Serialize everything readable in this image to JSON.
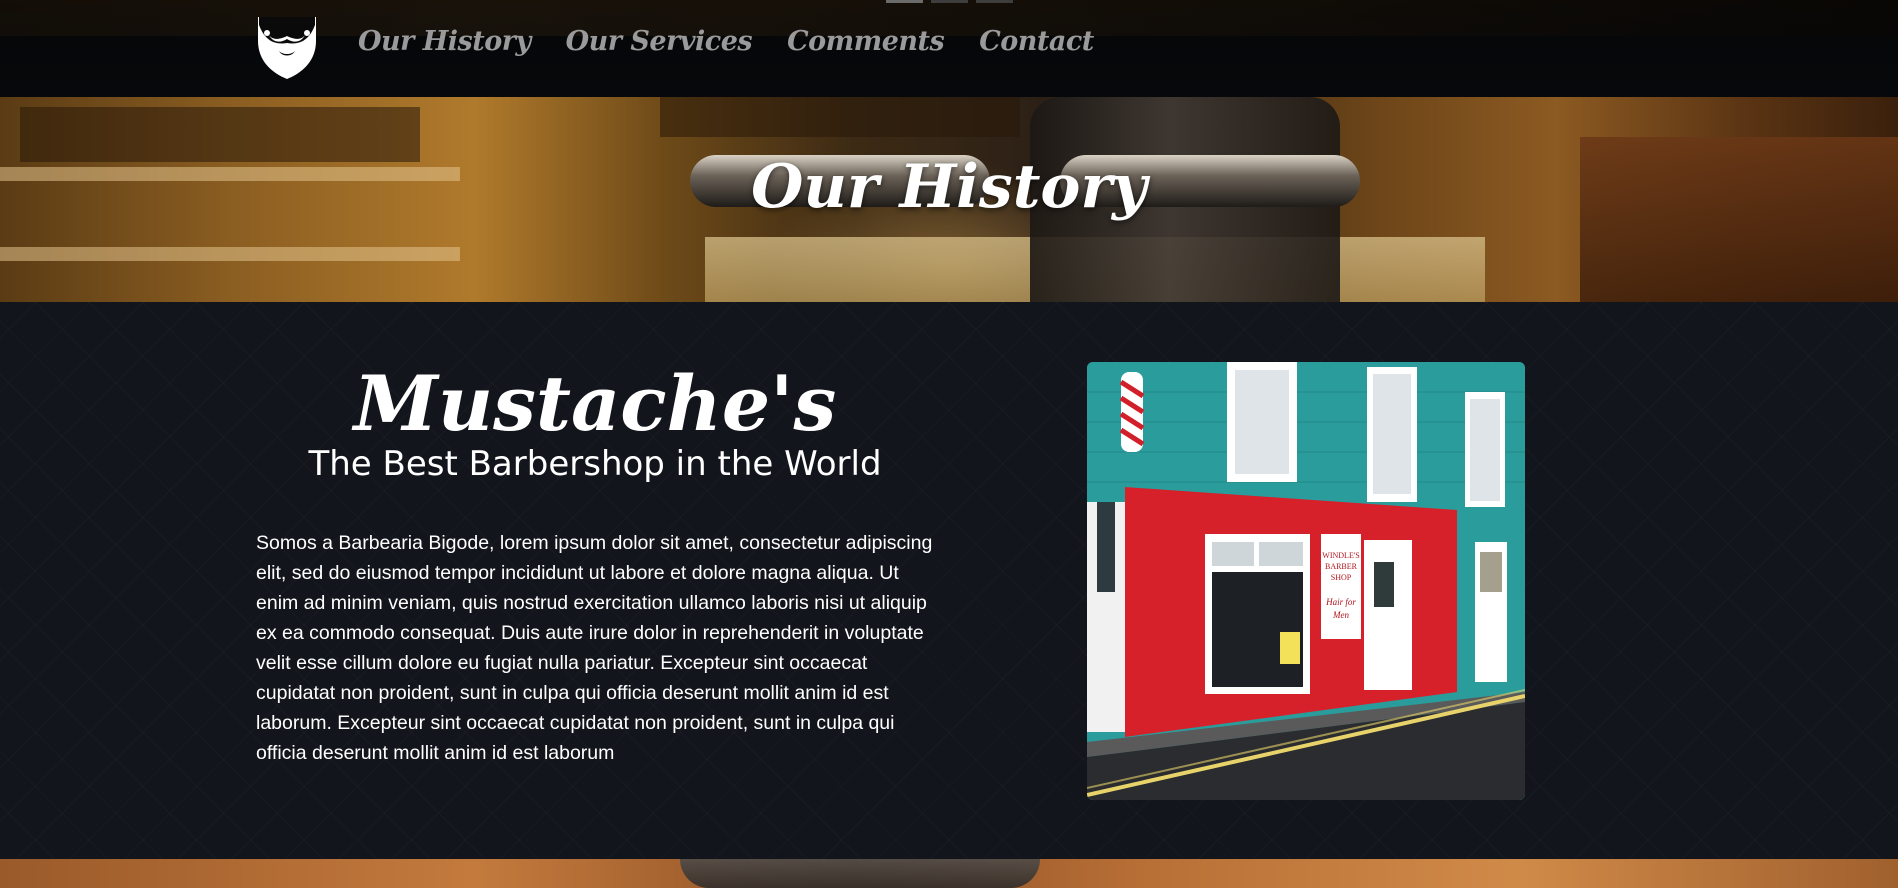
{
  "nav": {
    "links": [
      {
        "label": "Our History"
      },
      {
        "label": "Our Services"
      },
      {
        "label": "Comments"
      },
      {
        "label": "Contact"
      }
    ],
    "logo_icon": "beard-mustache-logo"
  },
  "hero": {
    "title": "Our History"
  },
  "about": {
    "title": "Mustache's",
    "subtitle": "The Best Barbershop in the World",
    "text": "Somos a Barbearia Bigode, lorem ipsum dolor sit amet, consectetur adipiscing elit, sed do eiusmod tempor incididunt ut labore et dolore magna aliqua. Ut enim ad minim veniam, quis nostrud exercitation ullamco laboris nisi ut aliquip ex ea commodo consequat. Duis aute irure dolor in reprehenderit in voluptate velit esse cillum dolore eu fugiat nulla pariatur. Excepteur sint occaecat cupidatat non proident, sunt in culpa qui officia deserunt mollit anim id est laborum. Excepteur sint occaecat cupidatat non proident, sunt in culpa qui officia deserunt mollit anim id est laborum"
  },
  "photo": {
    "shop_sign": [
      "WINDLE'S",
      "BARBER",
      "SHOP"
    ],
    "shop_sign_tagline": [
      "Hair for",
      "Men"
    ]
  },
  "colors": {
    "background": "#13151c",
    "nav_link": "#9a9a9a",
    "text": "#ffffff"
  }
}
